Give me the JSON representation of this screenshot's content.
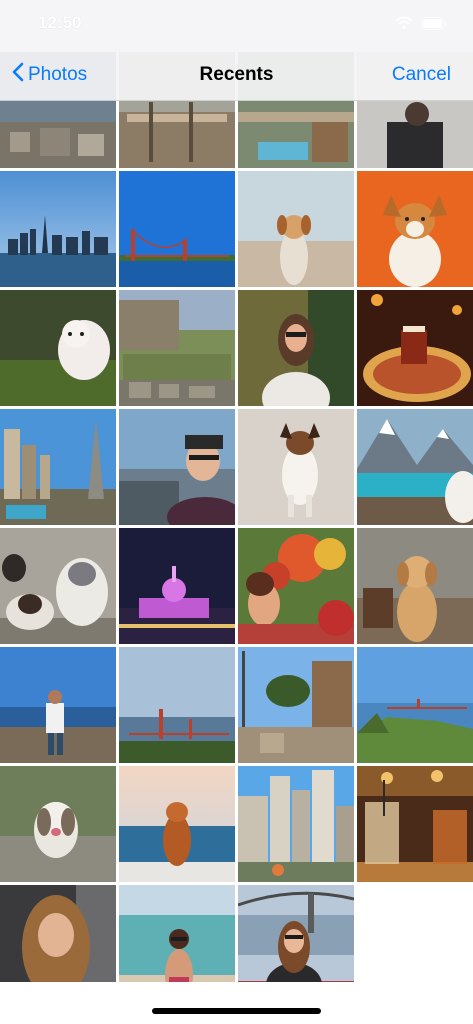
{
  "status_bar": {
    "time": "12:50"
  },
  "nav": {
    "back_label": "Photos",
    "title": "Recents",
    "cancel_label": "Cancel"
  },
  "colors": {
    "accent": "#0a7aff"
  },
  "photos": [
    "city-aerial",
    "harbor-pier",
    "rooftop-pool",
    "person-sitting",
    "city-skyline",
    "golden-gate-bridge",
    "dog-on-sand",
    "corgi-orange",
    "fluffy-dog-grass",
    "zoo-enclosure",
    "woman-portrait",
    "dessert-plate",
    "las-vegas-strip",
    "man-selfie",
    "dog-jumping-snow",
    "lake-mountains",
    "puppies-group",
    "city-hall-night",
    "woman-flowers",
    "golden-retriever",
    "man-coast",
    "golden-gate-fog",
    "cable-car",
    "bay-hills",
    "shih-tzu",
    "dog-beach",
    "city-buildings",
    "cocktails",
    "woman-car-selfie",
    "woman-beach",
    "woman-bridge"
  ]
}
